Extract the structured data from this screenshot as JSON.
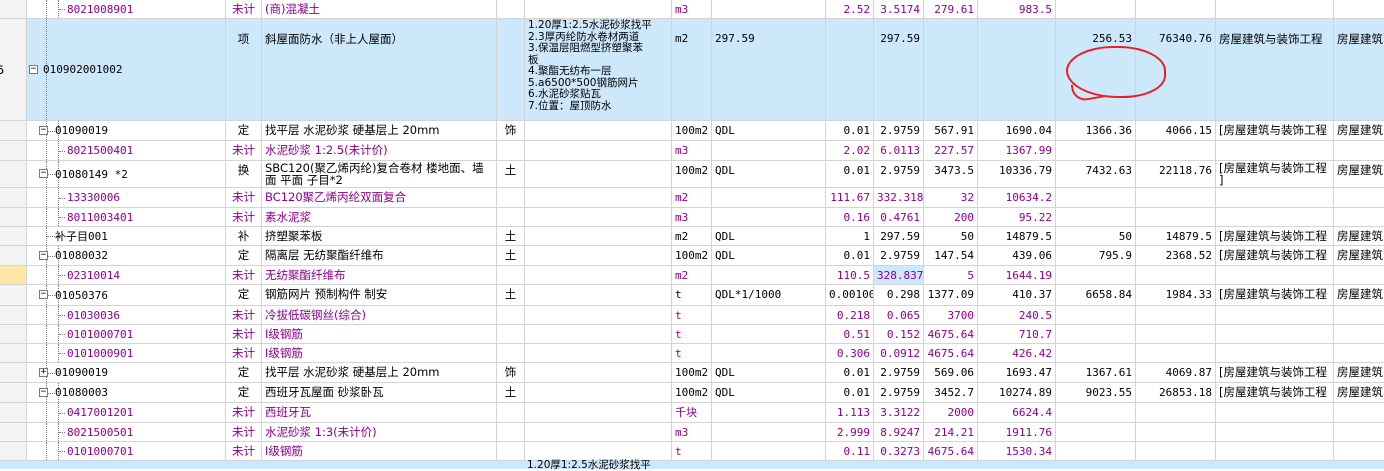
{
  "left_edge_label": "5",
  "rows": [
    {
      "code": "8021008901",
      "cat": "未计",
      "name": "(商)混凝土",
      "unit": "m3",
      "qty_expr": "",
      "c1": "2.52",
      "c2": "3.5174",
      "c3": "279.61",
      "c4": "983.5",
      "c5": "",
      "c6": "",
      "c7": "",
      "c8": "",
      "purple": true
    },
    {
      "code": "010902001002",
      "cat": "项",
      "name": "斜屋面防水（非上人屋面）",
      "features": [
        "1.20厚1:2.5水泥砂浆找平",
        "2.3厚丙纶防水卷材两道",
        "3.保温层阻燃型挤塑聚苯",
        "板",
        "4.聚酯无纺布一层",
        "5.a6500*500钢筋网片",
        "6.水泥砂浆贴瓦",
        "7.位置：屋顶防水"
      ],
      "unit": "m2",
      "qty_expr": "297.59",
      "c1": "",
      "c2": "297.59",
      "c3": "",
      "c4": "",
      "c5": "256.53",
      "c6": "76340.76",
      "c7": "房屋建筑与装饰工程",
      "c8": "房屋建筑"
    },
    {
      "code": "01090019",
      "cat": "定",
      "name": "找平层 水泥砂浆 硬基层上 20mm",
      "spec": "饰",
      "unit": "100m2",
      "qty_expr": "QDL",
      "c1": "0.01",
      "c2": "2.9759",
      "c3": "567.91",
      "c4": "1690.04",
      "c5": "1366.36",
      "c6": "4066.15",
      "c7": "[房屋建筑与装饰工程",
      "c8": "房屋建筑"
    },
    {
      "code": "8021500401",
      "cat": "未计",
      "name": "水泥砂浆 1:2.5(未计价)",
      "unit": "m3",
      "qty_expr": "",
      "c1": "2.02",
      "c2": "6.0113",
      "c3": "227.57",
      "c4": "1367.99",
      "c5": "",
      "c6": "",
      "c7": "",
      "c8": "",
      "purple": true
    },
    {
      "code": "01080149 *2",
      "cat": "换",
      "name": "SBC120(聚乙烯丙纶)复合卷材 楼地面、墙",
      "name2": "面 平面 子目*2",
      "spec": "土",
      "unit": "100m2",
      "qty_expr": "QDL",
      "c1": "0.01",
      "c2": "2.9759",
      "c3": "3473.5",
      "c4": "10336.79",
      "c5": "7432.63",
      "c6": "22118.76",
      "c7": "[房屋建筑与装饰工程",
      "c7b": "]",
      "c8": "房屋建筑"
    },
    {
      "code": "13330006",
      "cat": "未计",
      "name": "BC120聚乙烯丙纶双面复合",
      "unit": "m2",
      "qty_expr": "",
      "c1": "111.67",
      "c2": "332.3188",
      "c3": "32",
      "c4": "10634.2",
      "c5": "",
      "c6": "",
      "c7": "",
      "c8": "",
      "purple": true
    },
    {
      "code": "8011003401",
      "cat": "未计",
      "name": "素水泥浆",
      "unit": "m3",
      "qty_expr": "",
      "c1": "0.16",
      "c2": "0.4761",
      "c3": "200",
      "c4": "95.22",
      "c5": "",
      "c6": "",
      "c7": "",
      "c8": "",
      "purple": true
    },
    {
      "code": "补子目001",
      "cat": "补",
      "name": "挤塑聚苯板",
      "spec": "土",
      "unit": "m2",
      "qty_expr": "QDL",
      "c1": "1",
      "c2": "297.59",
      "c3": "50",
      "c4": "14879.5",
      "c5": "50",
      "c6": "14879.5",
      "c7": "[房屋建筑与装饰工程",
      "c8": "房屋建筑"
    },
    {
      "code": "01080032",
      "cat": "定",
      "name": "隔离层 无纺聚酯纤维布",
      "spec": "土",
      "unit": "100m2",
      "qty_expr": "QDL",
      "c1": "0.01",
      "c2": "2.9759",
      "c3": "147.54",
      "c4": "439.06",
      "c5": "795.9",
      "c6": "2368.52",
      "c7": "[房屋建筑与装饰工程",
      "c8": "房屋建筑"
    },
    {
      "code": "02310014",
      "cat": "未计",
      "name": "无纺聚酯纤维布",
      "unit": "m2",
      "qty_expr": "",
      "c1": "110.5",
      "c2": "328.837",
      "c3": "5",
      "c4": "1644.19",
      "c5": "",
      "c6": "",
      "c7": "",
      "c8": "",
      "purple": true
    },
    {
      "code": "01050376",
      "cat": "定",
      "name": "钢筋网片 预制构件 制安",
      "spec": "土",
      "unit": "t",
      "qty_expr": "QDL*1/1000",
      "c1": "0.00100",
      "c2": "0.298",
      "c3": "1377.09",
      "c4": "410.37",
      "c5": "6658.84",
      "c6": "1984.33",
      "c7": "[房屋建筑与装饰工程",
      "c8": "房屋建筑"
    },
    {
      "code": "01030036",
      "cat": "未计",
      "name": "冷拔低碳钢丝(综合)",
      "unit": "t",
      "qty_expr": "",
      "c1": "0.218",
      "c2": "0.065",
      "c3": "3700",
      "c4": "240.5",
      "c5": "",
      "c6": "",
      "c7": "",
      "c8": "",
      "purple": true
    },
    {
      "code": "0101000701",
      "cat": "未计",
      "name": "Ⅰ级钢筋",
      "unit": "t",
      "qty_expr": "",
      "c1": "0.51",
      "c2": "0.152",
      "c3": "4675.64",
      "c4": "710.7",
      "c5": "",
      "c6": "",
      "c7": "",
      "c8": "",
      "purple": true
    },
    {
      "code": "0101000901",
      "cat": "未计",
      "name": "Ⅰ级钢筋",
      "unit": "t",
      "qty_expr": "",
      "c1": "0.306",
      "c2": "0.0912",
      "c3": "4675.64",
      "c4": "426.42",
      "c5": "",
      "c6": "",
      "c7": "",
      "c8": "",
      "purple": true
    },
    {
      "code": "01090019",
      "cat": "定",
      "name": "找平层 水泥砂浆 硬基层上 20mm",
      "spec": "饰",
      "unit": "100m2",
      "qty_expr": "QDL",
      "c1": "0.01",
      "c2": "2.9759",
      "c3": "569.06",
      "c4": "1693.47",
      "c5": "1367.61",
      "c6": "4069.87",
      "c7": "[房屋建筑与装饰工程",
      "c8": "房屋建筑"
    },
    {
      "code": "01080003",
      "cat": "定",
      "name": "西班牙瓦屋面 砂浆卧瓦",
      "spec": "土",
      "unit": "100m2",
      "qty_expr": "QDL",
      "c1": "0.01",
      "c2": "2.9759",
      "c3": "3452.7",
      "c4": "10274.89",
      "c5": "9023.55",
      "c6": "26853.18",
      "c7": "[房屋建筑与装饰工程",
      "c8": "房屋建筑"
    },
    {
      "code": "0417001201",
      "cat": "未计",
      "name": "西班牙瓦",
      "unit": "千块",
      "qty_expr": "",
      "c1": "1.113",
      "c2": "3.3122",
      "c3": "2000",
      "c4": "6624.4",
      "c5": "",
      "c6": "",
      "c7": "",
      "c8": "",
      "purple": true
    },
    {
      "code": "8021500501",
      "cat": "未计",
      "name": "水泥砂浆 1:3(未计价)",
      "unit": "m3",
      "qty_expr": "",
      "c1": "2.999",
      "c2": "8.9247",
      "c3": "214.21",
      "c4": "1911.76",
      "c5": "",
      "c6": "",
      "c7": "",
      "c8": "",
      "purple": true
    },
    {
      "code": "0101000701",
      "cat": "未计",
      "name": "Ⅰ级钢筋",
      "unit": "t",
      "qty_expr": "",
      "c1": "0.11",
      "c2": "0.3273",
      "c3": "4675.64",
      "c4": "1530.34",
      "c5": "",
      "c6": "",
      "c7": "",
      "c8": "",
      "purple": true
    }
  ],
  "next_feature_partial": "1.20厚1:2.5水泥砂浆找平",
  "colors": {
    "selected_row": "#cde8fb",
    "material_text": "#8b008b",
    "annotation": "#ee1c24",
    "grid_line": "#d4d4d4"
  }
}
